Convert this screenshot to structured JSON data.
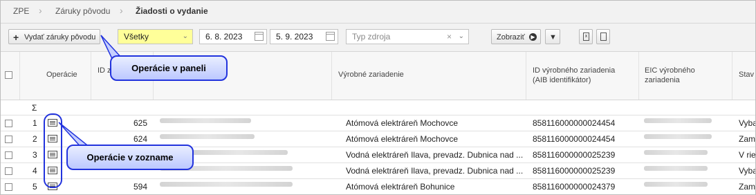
{
  "breadcrumb": {
    "items": [
      "ZPE",
      "Záruky pôvodu",
      "Žiadosti o vydanie"
    ]
  },
  "toolbar": {
    "issue_button": "Vydať záruky pôvodu",
    "filter_select": "Všetky",
    "date_from": "6. 8. 2023",
    "date_to": "5. 9. 2023",
    "source_type_placeholder": "Typ zdroja",
    "show_button": "Zobraziť",
    "colors": {
      "filter_select_bg": "#ffff99",
      "callout_border": "#2233dd"
    }
  },
  "table": {
    "columns": [
      "Operácie",
      "ID zázn",
      "Výrobné zariadenie",
      "ID výrobného zariadenia (AIB identifikátor)",
      "EIC výrobného zariadenia",
      "Stav"
    ],
    "sum_symbol": "Σ",
    "rows": [
      {
        "n": "1",
        "id": "625",
        "device": "Atómová elektráreň Mochovce",
        "aib": "858116000000024454",
        "state": "Vyba"
      },
      {
        "n": "2",
        "id": "624",
        "device": "Atómová elektráreň Mochovce",
        "aib": "858116000000024454",
        "state": "Zami"
      },
      {
        "n": "3",
        "id": "",
        "device": "Vodná elektráreň Ilava, prevadz. Dubnica nad ...",
        "aib": "858116000000025239",
        "state": "V ries"
      },
      {
        "n": "4",
        "id": "",
        "device": "Vodná elektráreň Ilava, prevadz. Dubnica nad ...",
        "aib": "858116000000025239",
        "state": "Vyba"
      },
      {
        "n": "5",
        "id": "594",
        "device": "Atómová elektráreň Bohunice",
        "aib": "858116000000024379",
        "state": "Zami"
      }
    ]
  },
  "callouts": {
    "panel": "Operácie v paneli",
    "list": "Operácie v zozname"
  },
  "icons": [
    "plus-icon",
    "chevron-down-icon",
    "calendar-icon",
    "clear-icon",
    "arrow-right-circle-icon",
    "filter-icon",
    "excel-export-icon",
    "document-export-icon",
    "list-icon"
  ]
}
